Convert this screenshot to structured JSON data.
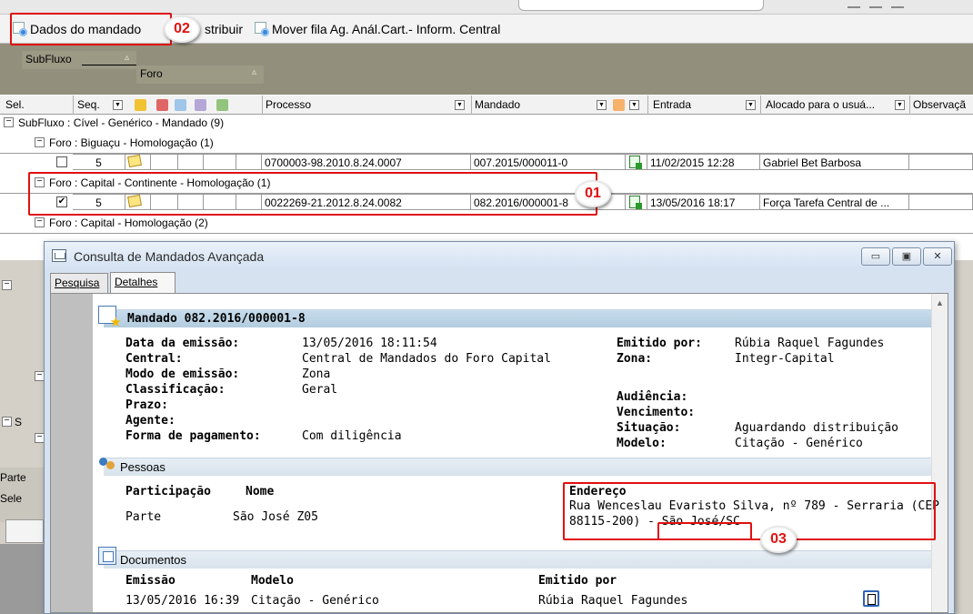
{
  "toolbar": {
    "dados_label": "Dados do mandado",
    "distribuir_label": "stribuir",
    "mover_label": "Mover fila Ag. Anál.Cart.- Inform. Central"
  },
  "grouping": {
    "subfluxo": "SubFluxo",
    "foro": "Foro"
  },
  "columns": {
    "sel": "Sel.",
    "seq": "Seq.",
    "processo": "Processo",
    "mandado": "Mandado",
    "entrada": "Entrada",
    "alocado": "Alocado para o usuá...",
    "observacao": "Observaçã"
  },
  "grid": {
    "group_subfluxo": "SubFluxo : Cível - Genérico - Mandado  (9)",
    "group_biguacu": "Foro : Biguaçu - Homologação  (1)",
    "row1": {
      "seq": "5",
      "processo": "0700003-98.2010.8.24.0007",
      "mandado": "007.2015/000011-0",
      "entrada": "11/02/2015 12:28",
      "alocado": "Gabriel Bet Barbosa"
    },
    "group_continente": "Foro : Capital - Continente - Homologação  (1)",
    "row2": {
      "check": "✔",
      "seq": "5",
      "processo": "0022269-21.2012.8.24.0082",
      "mandado": "082.2016/000001-8",
      "entrada": "13/05/2016 18:17",
      "alocado": "Força Tarefa Central de ..."
    },
    "group_capital": "Foro : Capital - Homologação  (2)"
  },
  "left_pane": {
    "s": "S",
    "parte": "Parte",
    "sele": "Sele"
  },
  "callouts": {
    "c01": "01",
    "c02": "02",
    "c03": "03"
  },
  "dialog": {
    "title": "Consulta de Mandados Avançada",
    "min_glyph": "▭",
    "max_glyph": "▣",
    "close_glyph": "✕",
    "tabs": {
      "pesquisa": "Pesquisa",
      "detalhes": "Detalhes"
    },
    "mandado_header": "Mandado 082.2016/000001-8",
    "fields": {
      "data_emissao_label": "Data da emissão:",
      "data_emissao_value": "13/05/2016 18:11:54",
      "central_label": "Central:",
      "central_value": "Central de Mandados do Foro Capital",
      "modo_label": "Modo de emissão:",
      "modo_value": "Zona",
      "classificacao_label": "Classificação:",
      "classificacao_value": "Geral",
      "prazo_label": "Prazo:",
      "agente_label": "Agente:",
      "forma_label": "Forma de pagamento:",
      "forma_value": "Com diligência",
      "emitido_label": "Emitido por:",
      "emitido_value": "Rúbia Raquel Fagundes",
      "zona_label": "Zona:",
      "zona_value": "Integr-Capital",
      "audiencia_label": "Audiência:",
      "vencimento_label": "Vencimento:",
      "situacao_label": "Situação:",
      "situacao_value": "Aguardando distribuição",
      "modelo_label": "Modelo:",
      "modelo_value": "Citação - Genérico"
    },
    "pessoas": {
      "header": "Pessoas",
      "participacao_head": "Participação",
      "nome_head": "Nome",
      "endereco_head": "Endereço",
      "participacao": "Parte",
      "nome": "São José Z05",
      "endereco_line1": "Rua Wenceslau Evaristo Silva, nº 789 - Serraria (CEP",
      "endereco_line2_a": "88115-200) - ",
      "endereco_line2_b": "São José/SC"
    },
    "documentos": {
      "header": "Documentos",
      "emissao_head": "Emissão",
      "modelo_head": "Modelo",
      "emitido_head": "Emitido por",
      "emissao": "13/05/2016 16:39",
      "modelo": "Citação - Genérico",
      "emitido": "Rúbia Raquel Fagundes"
    }
  }
}
